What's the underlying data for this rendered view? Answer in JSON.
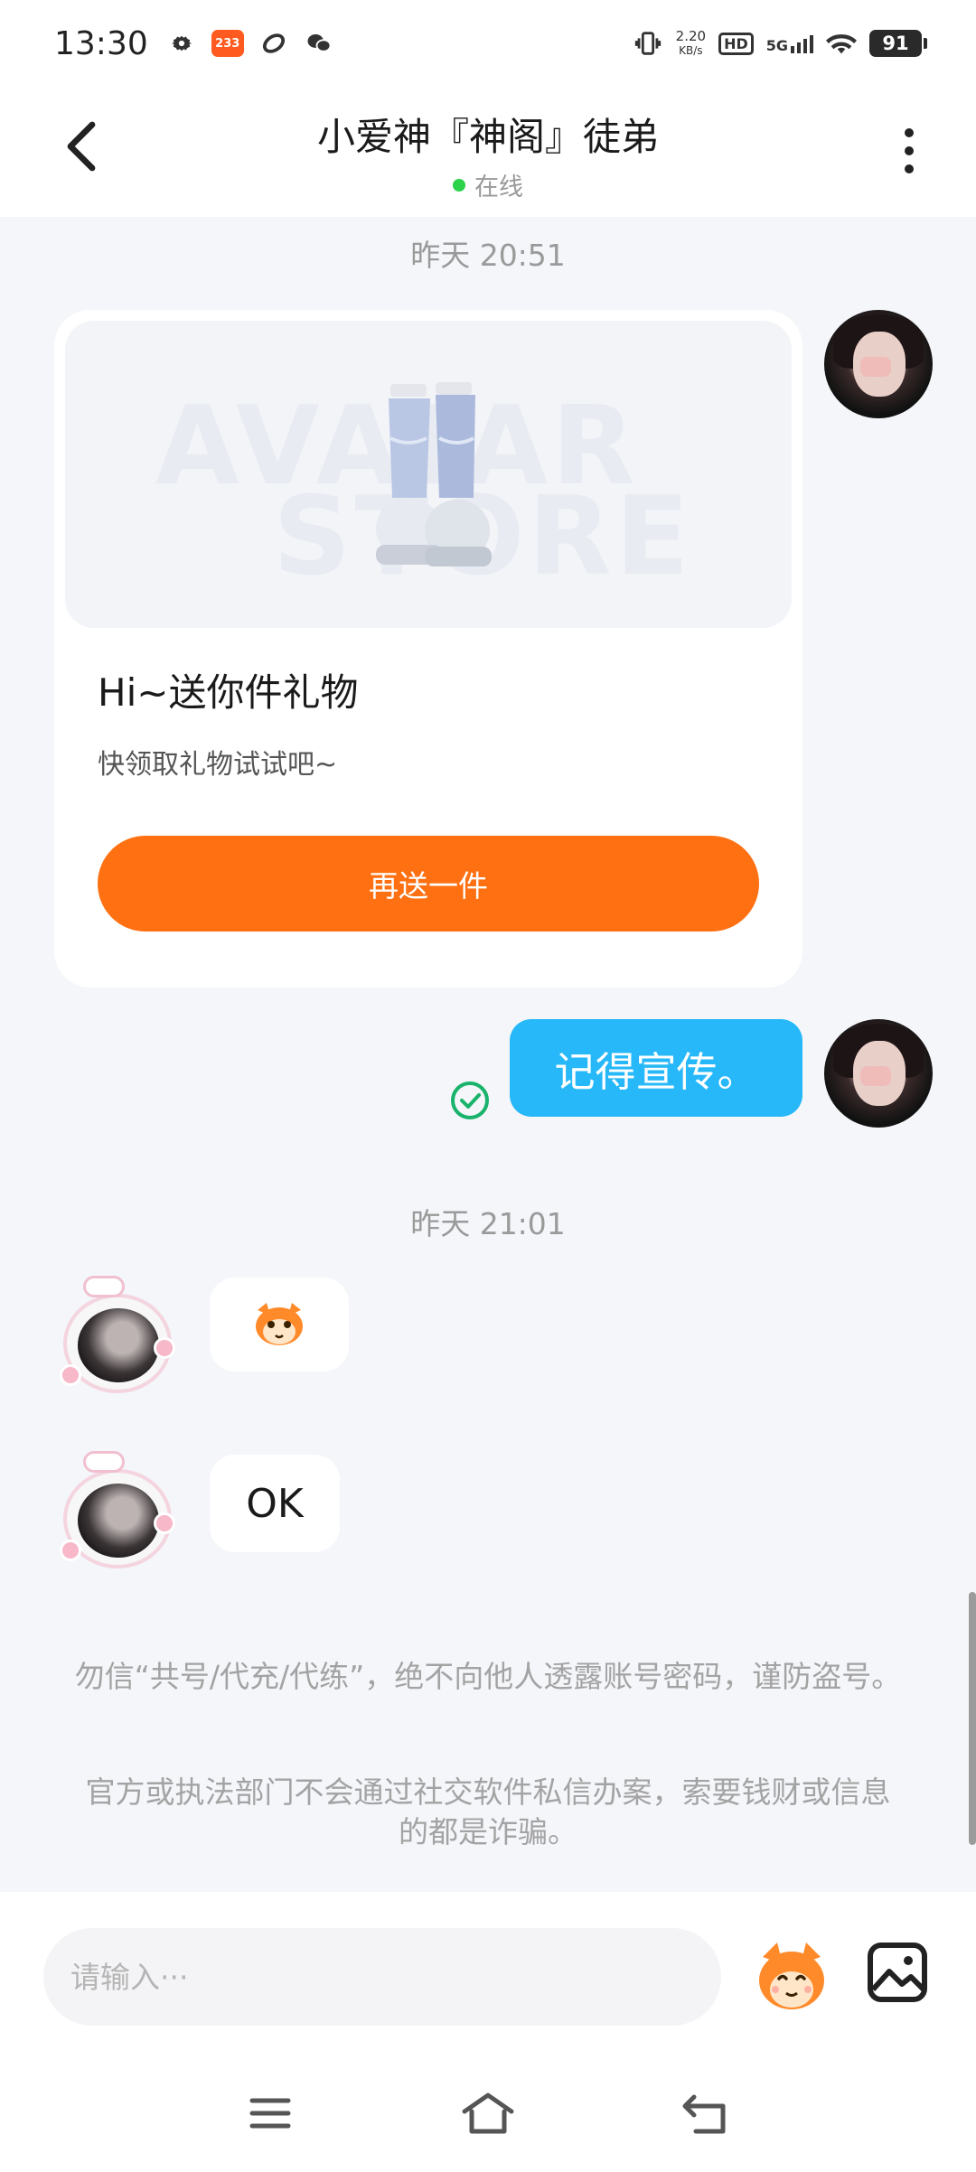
{
  "status_bar": {
    "time": "13:30",
    "app_badge": "233",
    "net_speed_value": "2.20",
    "net_speed_unit": "KB/s",
    "hd": "HD",
    "network": "5G",
    "battery": "91"
  },
  "header": {
    "title": "小爱神『神阁』徒弟",
    "status": "在线"
  },
  "chat": {
    "timestamp_1": "昨天 20:51",
    "gift_card": {
      "title": "Hi~送你件礼物",
      "subtitle": "快领取礼物试试吧~",
      "button_label": "再送一件",
      "watermark_1": "AVATAR",
      "watermark_2": "STORE"
    },
    "sent_message": "记得宣传。",
    "timestamp_2": "昨天 21:01",
    "received_message": "OK",
    "notice_1": "勿信“共号/代充/代练”，绝不向他人透露账号密码，谨防盗号。",
    "notice_2": "官方或执法部门不会通过社交软件私信办案，索要钱财或信息的都是诈骗。"
  },
  "input": {
    "placeholder": "请输入···"
  },
  "colors": {
    "accent_orange": "#fe7011",
    "bubble_blue": "#26b8f8",
    "online_green": "#2bd24a"
  }
}
